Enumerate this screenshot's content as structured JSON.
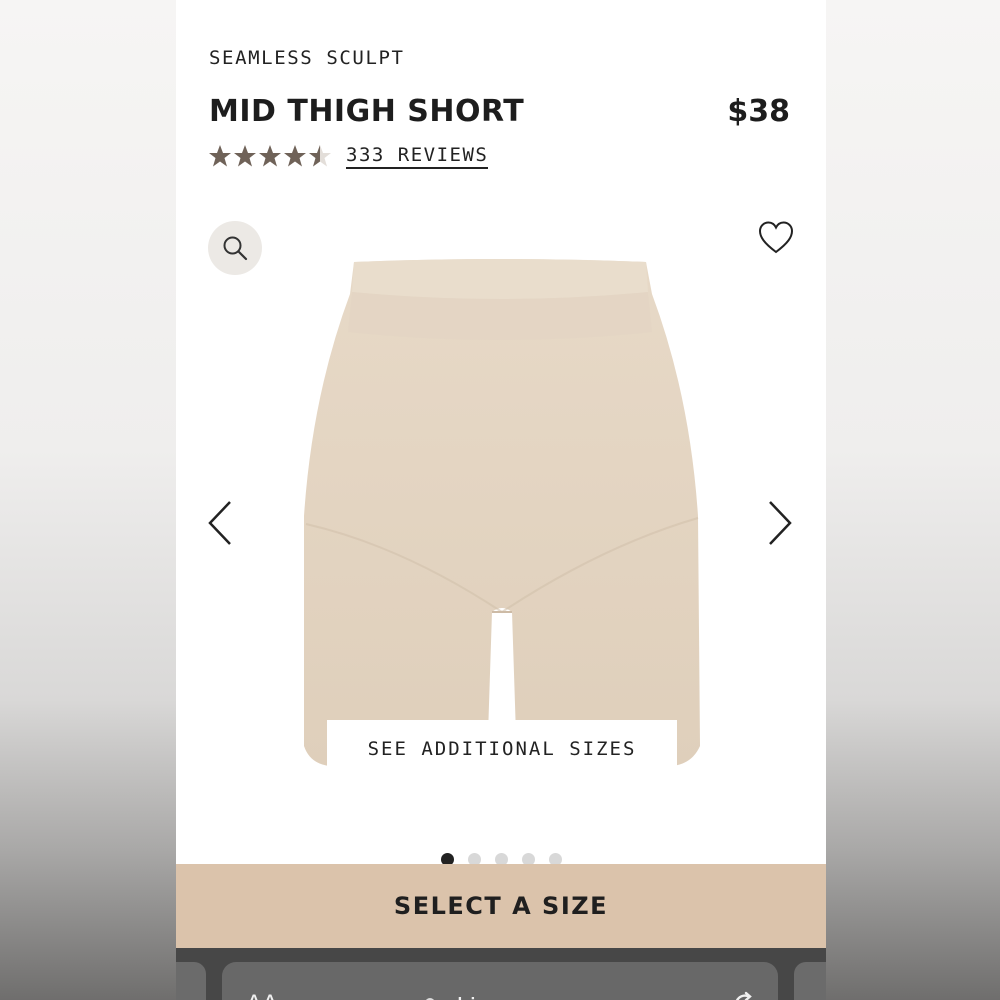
{
  "product": {
    "collection": "SEAMLESS SCULPT",
    "name": "MID THIGH SHORT",
    "price": "$38",
    "rating": 4.5,
    "reviews_label": "333 REVIEWS",
    "color": "#e6d6c4"
  },
  "gallery": {
    "see_sizes_label": "SEE ADDITIONAL SIZES",
    "slide_count": 5,
    "active_slide": 1
  },
  "cta": {
    "select_size_label": "SELECT A SIZE",
    "background": "#dbc3ab"
  },
  "browser": {
    "aa_label": "AA",
    "url": "skims.com"
  },
  "icons": {
    "zoom": "search-icon",
    "wishlist": "heart-icon",
    "prev": "chevron-left-icon",
    "next": "chevron-right-icon",
    "lock": "lock-icon",
    "reload": "reload-icon"
  }
}
